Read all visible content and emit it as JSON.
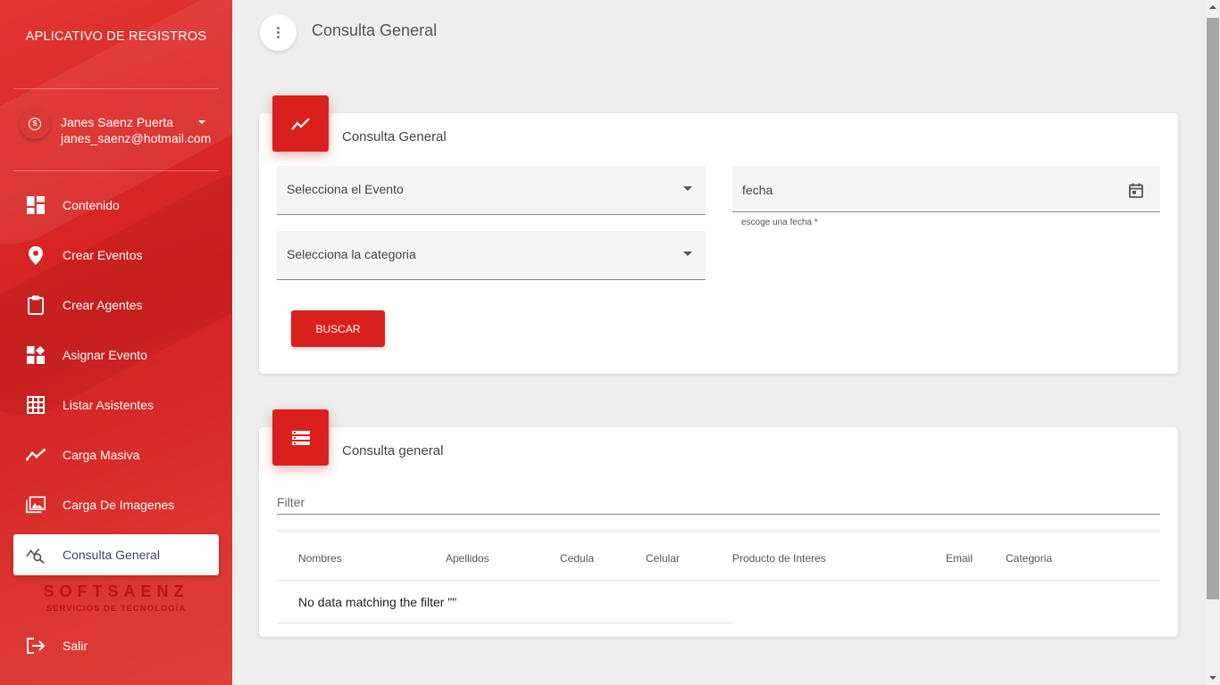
{
  "sidebar": {
    "brand": "APLICATIVO DE REGISTROS",
    "user": {
      "name": "Janes Saenz Puerta",
      "email": "janes_saenz@hotmail.com"
    },
    "items": [
      {
        "label": "Contenido",
        "icon": "dashboard-icon"
      },
      {
        "label": "Crear Eventos",
        "icon": "location-pin-icon"
      },
      {
        "label": "Crear Agentes",
        "icon": "clipboard-icon"
      },
      {
        "label": "Asignar Evento",
        "icon": "widgets-icon"
      },
      {
        "label": "Listar Asistentes",
        "icon": "grid-icon"
      },
      {
        "label": "Carga Masiva",
        "icon": "trending-line-icon"
      },
      {
        "label": "Carga De Imagenes",
        "icon": "photo-library-icon"
      },
      {
        "label": "Consulta General",
        "icon": "query-stats-icon",
        "active": true
      }
    ],
    "footer_logo": {
      "name": "SOFTSAENZ",
      "tagline": "SERVICIOS DE TECNOLOGÍA"
    },
    "logout": "Salir"
  },
  "header": {
    "title": "Consulta General"
  },
  "search_card": {
    "title": "Consulta General",
    "event_select": "Selecciona el Evento",
    "category_select": "Selecciona la categoria",
    "date_field": "fecha",
    "date_hint": "escoge una fecha *",
    "button": "BUSCAR"
  },
  "results_card": {
    "title": "Consulta general",
    "filter_placeholder": "Filter",
    "columns": [
      "Nombres",
      "Apellidos",
      "Cedula",
      "Celular",
      "Producto de Interes",
      "Email",
      "Categoria"
    ],
    "empty_message": "No data matching the filter \"\""
  },
  "colors": {
    "primary": "#d9201c",
    "background": "#eeeeee"
  }
}
